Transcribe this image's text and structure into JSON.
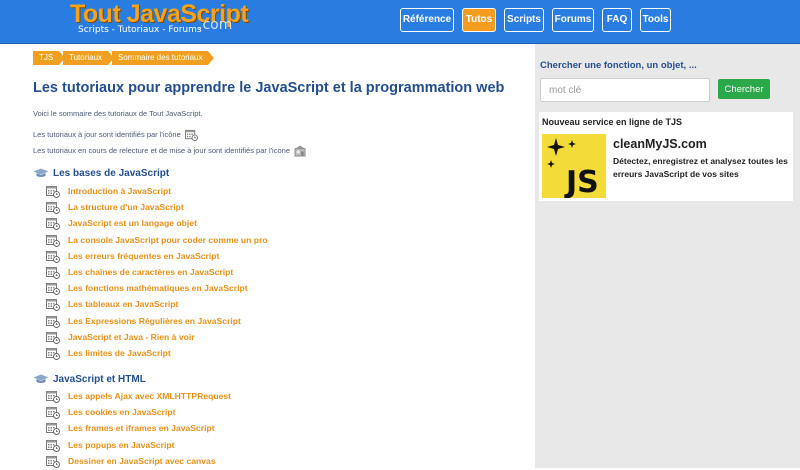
{
  "header": {
    "logo_title": "Tout JavaScript",
    "logo_subtitle": "Scripts - Tutoriaux - Forums",
    "logo_tld": ".com",
    "nav": [
      {
        "label": "Référence",
        "active": false
      },
      {
        "label": "Tutos",
        "active": true
      },
      {
        "label": "Scripts",
        "active": false
      },
      {
        "label": "Forums",
        "active": false
      },
      {
        "label": "FAQ",
        "active": false
      },
      {
        "label": "Tools",
        "active": false
      }
    ]
  },
  "breadcrumb": [
    "TJS",
    "Tutoriaux",
    "Sommaire des tutoriaux"
  ],
  "main": {
    "title": "Les tutoriaux pour apprendre le JavaScript et la programmation web",
    "intro": "Voici le sommaire des tutoriaux de Tout JavaScript.",
    "legend_updated": "Les tutoriaux à jour sont identifiés par l'icône",
    "legend_review": "Les tutoriaux en cours de relecture et de mise à jour sont identifiés par l'icone",
    "sections": [
      {
        "title": "Les bases de JavaScript",
        "items": [
          "Introduction à JavaScript",
          "La structure d'un JavaScript",
          "JavaScript est un langage objet",
          "La console JavaScript pour coder comme un pro",
          "Les erreurs fréquentes en JavaScript",
          "Les chaînes de caractères en JavaScript",
          "Les fonctions mathématiques en JavaScript",
          "Les tableaux en JavaScript",
          "Les Expressions Régulières en JavaScript",
          "JavaScript et Java - Rien à voir",
          "Les limites de JavaScript"
        ]
      },
      {
        "title": "JavaScript et HTML",
        "items": [
          "Les appels Ajax avec XMLHTTPRequest",
          "Les cookies en JavaScript",
          "Les frames et iframes en JavaScript",
          "Les popups en JavaScript",
          "Dessiner en JavaScript avec canvas"
        ]
      }
    ]
  },
  "sidebar": {
    "search_label": "Chercher une fonction, un objet, ...",
    "search_placeholder": "mot clé",
    "search_button": "Chercher",
    "promo_heading": "Nouveau service en ligne de TJS",
    "promo_name": "cleanMyJS.com",
    "promo_description": "Détectez, enregistrez et analysez toutes les erreurs JavaScript de vos sites",
    "promo_logo_text": "JS"
  },
  "colors": {
    "header_blue": "#2a7de0",
    "accent_orange": "#f39c1f",
    "title_blue": "#244e8e",
    "link_orange": "#e8911a",
    "button_green": "#2aa84a",
    "promo_yellow": "#f3dc3a"
  },
  "icons": {
    "tutorial_item": "calendar-clock-icon",
    "section": "graduation-cap-icon",
    "review": "construction-icon"
  }
}
